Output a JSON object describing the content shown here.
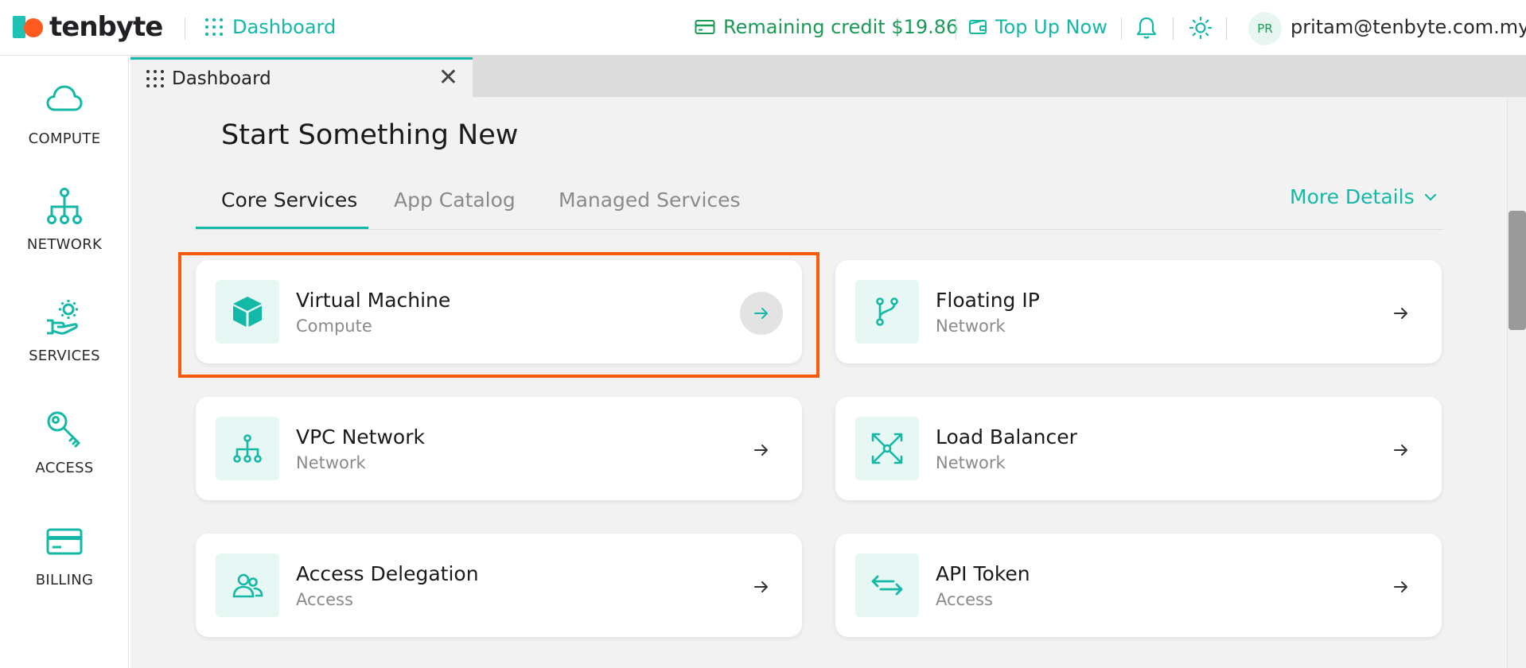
{
  "brand": {
    "name": "tenbyte",
    "colors": {
      "accent": "#14b8a6",
      "logo_orange": "#ff5a1f",
      "credit_green": "#1a9a57",
      "highlight": "#ff5a0a"
    }
  },
  "topbar": {
    "nav_label": "Dashboard",
    "credit_text": "Remaining credit $19.86",
    "topup_label": "Top Up Now",
    "avatar_initials": "PR",
    "user_email": "pritam@tenbyte.com.my"
  },
  "sidebar": {
    "items": [
      {
        "label": "COMPUTE",
        "icon": "cloud-icon"
      },
      {
        "label": "NETWORK",
        "icon": "network-icon"
      },
      {
        "label": "SERVICES",
        "icon": "services-icon"
      },
      {
        "label": "ACCESS",
        "icon": "key-icon"
      },
      {
        "label": "BILLING",
        "icon": "card-icon"
      }
    ]
  },
  "tabstrip": {
    "active_tab": "Dashboard"
  },
  "main": {
    "title": "Start Something New",
    "tabs": [
      "Core Services",
      "App Catalog",
      "Managed Services"
    ],
    "active_tab": "Core Services",
    "more_details": "More Details",
    "cards": [
      {
        "title": "Virtual Machine",
        "subtitle": "Compute",
        "icon": "cube-icon",
        "highlighted": true
      },
      {
        "title": "Floating IP",
        "subtitle": "Network",
        "icon": "branch-icon"
      },
      {
        "title": "VPC Network",
        "subtitle": "Network",
        "icon": "hierarchy-icon"
      },
      {
        "title": "Load Balancer",
        "subtitle": "Network",
        "icon": "expand-arrows-icon"
      },
      {
        "title": "Access Delegation",
        "subtitle": "Access",
        "icon": "users-icon"
      },
      {
        "title": "API Token",
        "subtitle": "Access",
        "icon": "swap-arrows-icon"
      }
    ]
  }
}
